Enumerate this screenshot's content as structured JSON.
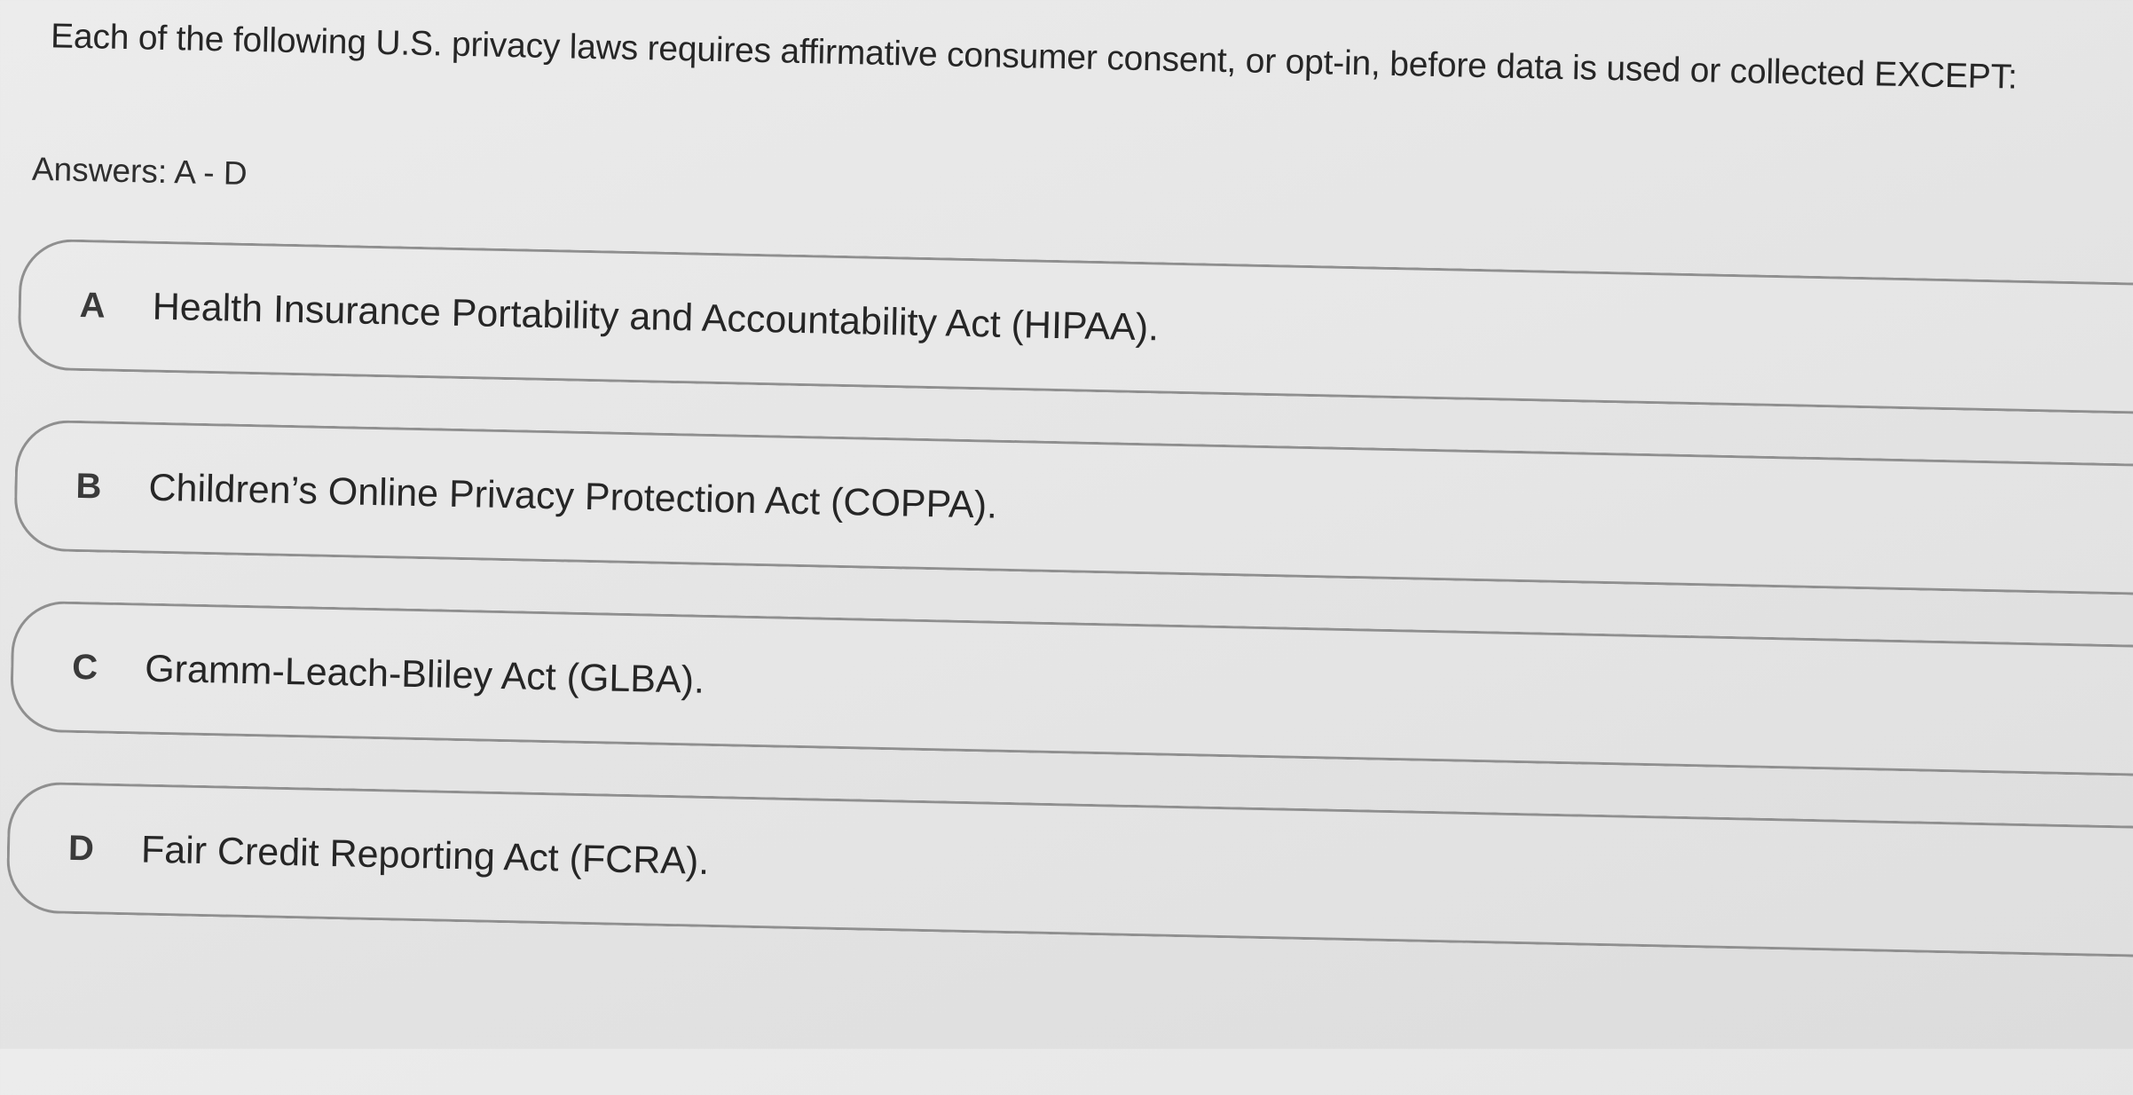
{
  "question": {
    "text": "Each of the following U.S. privacy laws requires affirmative consumer consent, or opt-in, before data is used or collected EXCEPT:"
  },
  "answers_hint": "Answers: A - D",
  "options": [
    {
      "letter": "A",
      "text": "Health Insurance Portability and Accountability Act (HIPAA)."
    },
    {
      "letter": "B",
      "text": "Children’s Online Privacy Protection Act (COPPA)."
    },
    {
      "letter": "C",
      "text": "Gramm-Leach-Bliley Act (GLBA)."
    },
    {
      "letter": "D",
      "text": "Fair Credit Reporting Act (FCRA)."
    }
  ],
  "colors": {
    "background": "#e6e6e6",
    "border": "#8f8f8f",
    "text": "#262626"
  }
}
